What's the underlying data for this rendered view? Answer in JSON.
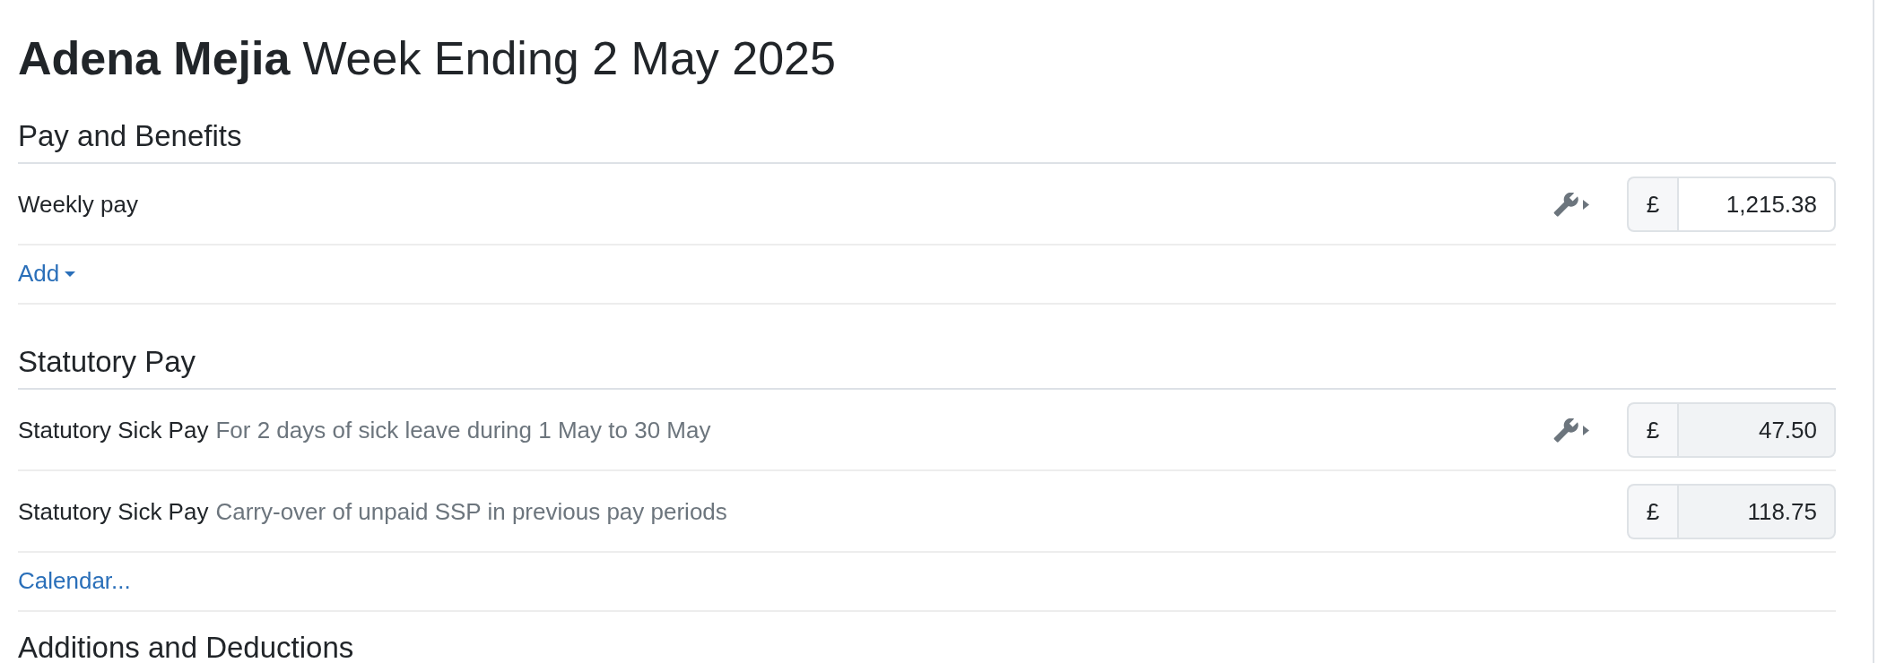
{
  "title": {
    "name": "Adena Mejia",
    "period": "Week Ending 2 May 2025"
  },
  "sections": [
    {
      "heading": "Pay and Benefits",
      "rows": [
        {
          "label": "Weekly pay",
          "tools_menu": true,
          "currency": "£",
          "amount": "1,215.38",
          "readonly": false
        }
      ],
      "action": {
        "label": "Add",
        "kind": "dropdown"
      }
    },
    {
      "heading": "Statutory Pay",
      "rows": [
        {
          "label": "Statutory Sick Pay",
          "note": "For 2 days of sick leave during 1 May to 30 May",
          "tools_menu": true,
          "currency": "£",
          "amount": "47.50",
          "readonly": true
        },
        {
          "label": "Statutory Sick Pay",
          "note": "Carry-over of unpaid SSP in previous pay periods",
          "tools_menu": false,
          "currency": "£",
          "amount": "118.75",
          "readonly": true
        }
      ],
      "action": {
        "label": "Calendar...",
        "kind": "link"
      }
    },
    {
      "heading": "Additions and Deductions"
    }
  ]
}
